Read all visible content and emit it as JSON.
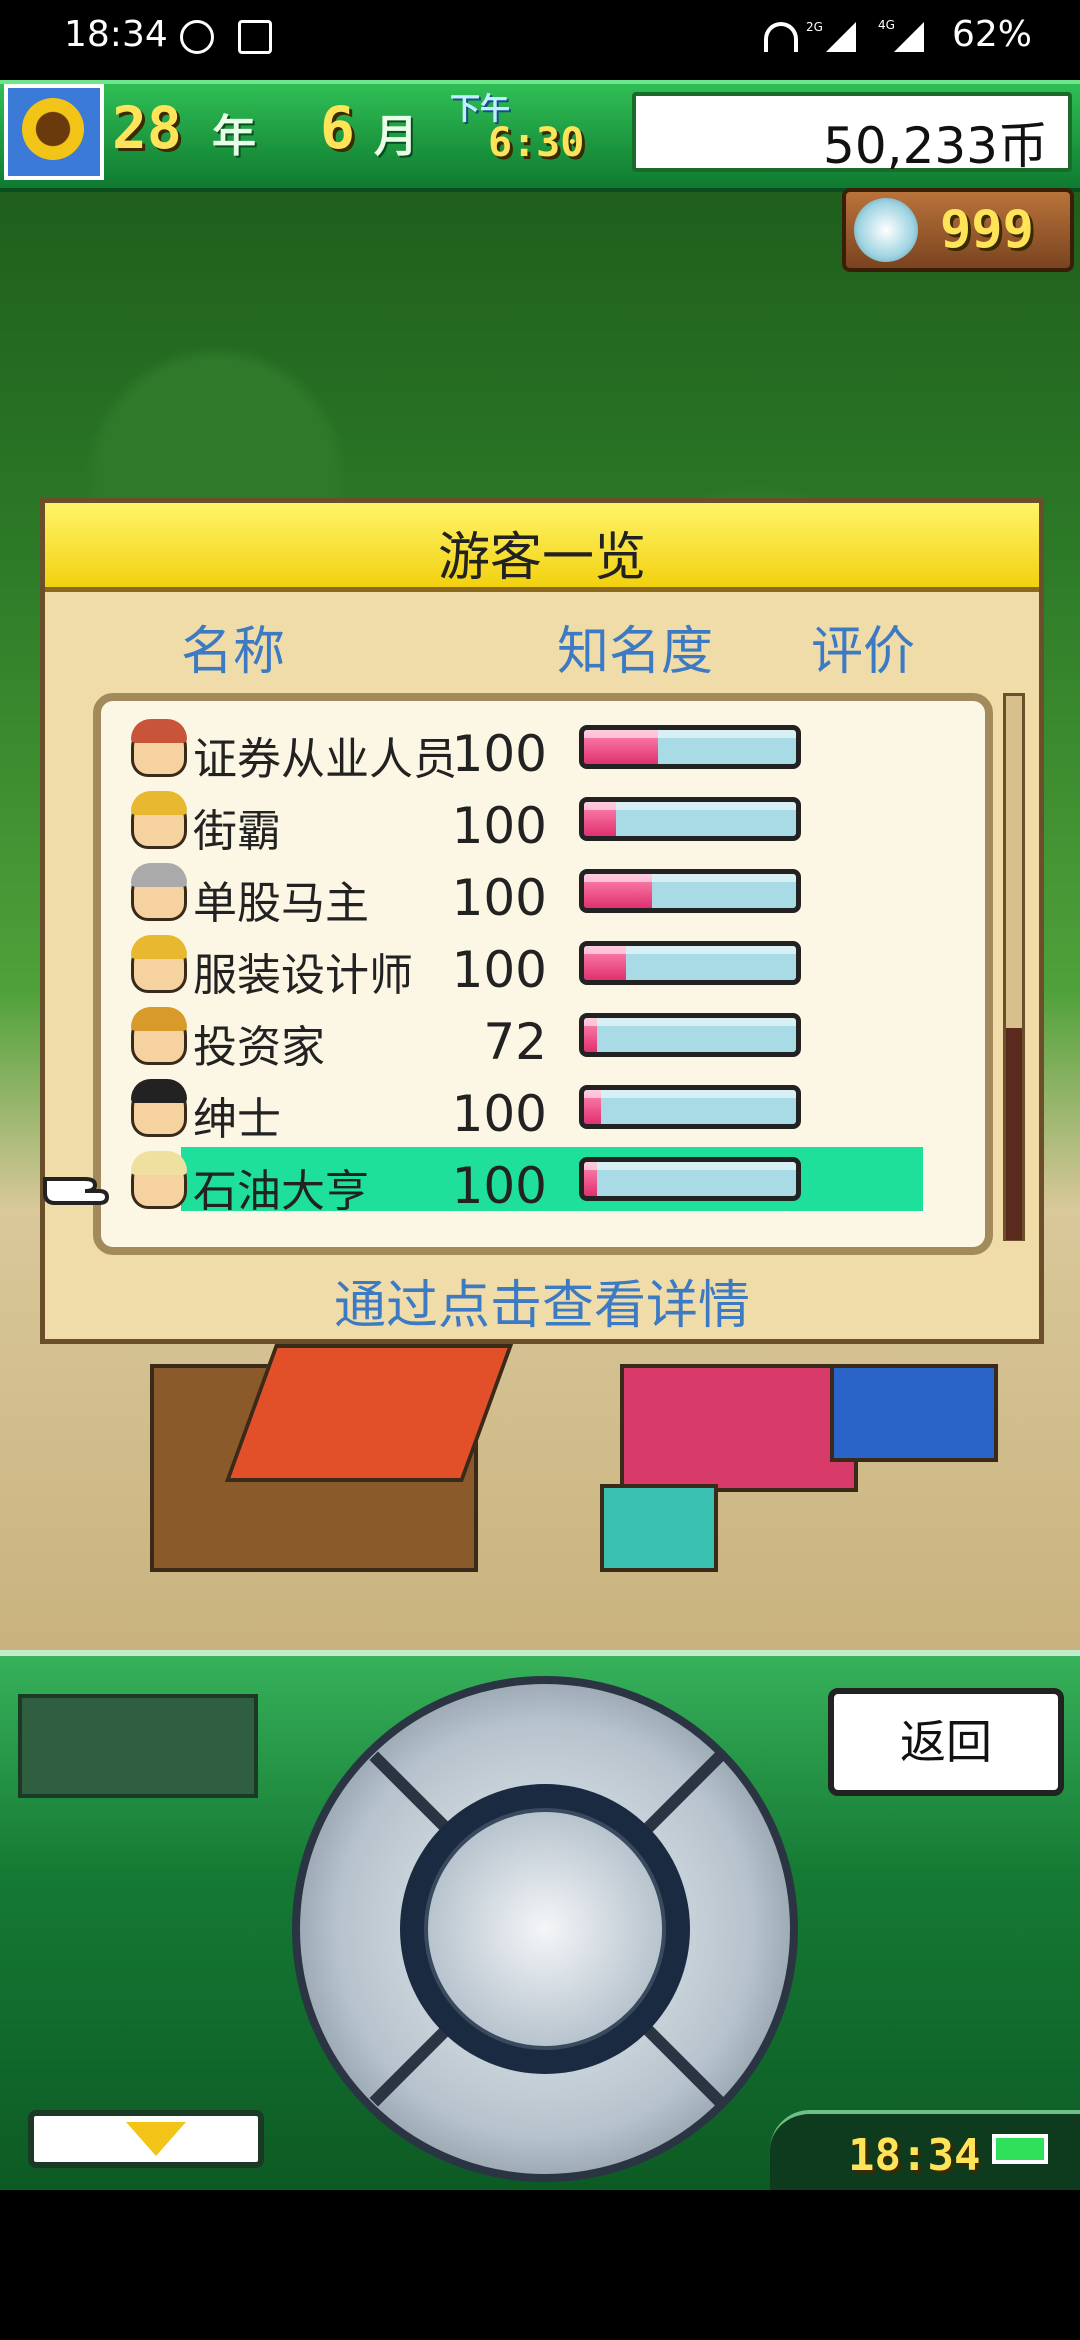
{
  "status_bar": {
    "time": "18:34",
    "battery": "62%",
    "network_1": "2G",
    "network_2": "4G"
  },
  "hud": {
    "year_num": "28",
    "year_unit": "年",
    "month_num": "6",
    "month_unit": "月",
    "ampm": "下午",
    "clock": "6:30",
    "money": "50,233币",
    "medals": "999"
  },
  "dialog": {
    "title": "游客一览",
    "columns": {
      "name": "名称",
      "fame": "知名度",
      "rating": "评价"
    },
    "hint": "通过点击查看详情",
    "visitors": [
      {
        "name": "证券从业人员",
        "fame": "100",
        "rating": 0.35,
        "hair": "#c8553a"
      },
      {
        "name": "街霸",
        "fame": "100",
        "rating": 0.15,
        "hair": "#e8b830"
      },
      {
        "name": "单股马主",
        "fame": "100",
        "rating": 0.32,
        "hair": "#aaaaaa"
      },
      {
        "name": "服装设计师",
        "fame": "100",
        "rating": 0.2,
        "hair": "#e8b830"
      },
      {
        "name": "投资家",
        "fame": "72",
        "rating": 0.06,
        "hair": "#d89a2a"
      },
      {
        "name": "绅士",
        "fame": "100",
        "rating": 0.08,
        "hair": "#222222"
      },
      {
        "name": "石油大亨",
        "fame": "100",
        "rating": 0.06,
        "hair": "#f0e0a0"
      }
    ],
    "selected_index": 6
  },
  "controller": {
    "back_label": "返回",
    "clock": "18:34"
  },
  "colors": {
    "accent_yellow": "#f2d10f",
    "panel": "#f0dca8",
    "header_blue": "#3c7ac4",
    "selected": "#1ee09a",
    "hud_green": "#1e9a42"
  }
}
